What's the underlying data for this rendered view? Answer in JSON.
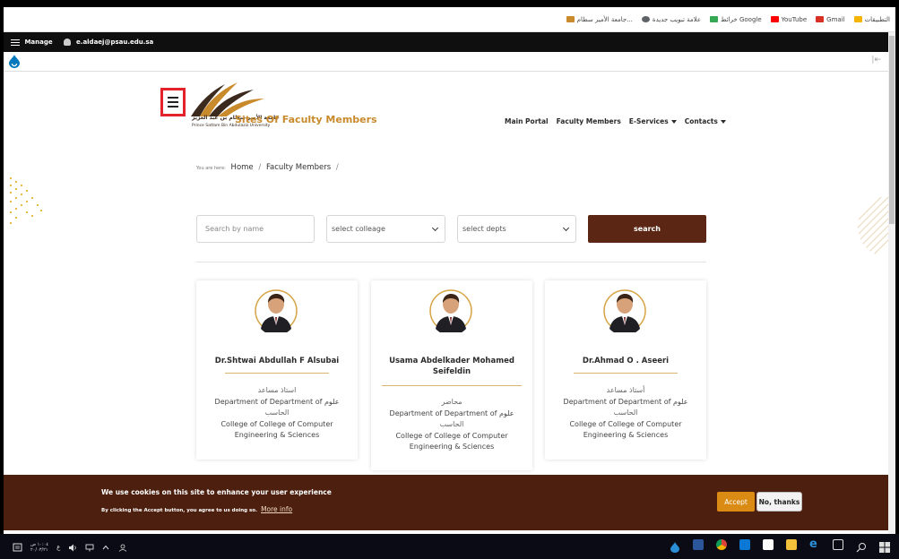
{
  "browser": {
    "bookmarks": [
      {
        "label": "التطبيقات",
        "color": "#f4b400"
      },
      {
        "label": "Gmail",
        "color": "#d93025"
      },
      {
        "label": "YouTube",
        "color": "#ff0000"
      },
      {
        "label": "خرائط Google",
        "color": "#34a853"
      },
      {
        "label": "علامة تبويب جديدة",
        "color": "#5f6368"
      },
      {
        "label": "جامعة الأمير سطام...",
        "color": "#c98a2c"
      }
    ]
  },
  "admin_toolbar": {
    "manage_label": "Manage",
    "user_label": "e.aldaej@psau.edu.sa",
    "collapse_glyph": "|⇤"
  },
  "header": {
    "university_name_ar": "جامعة الأمير سطام بن عبد العزيز",
    "university_name_en": "Prince Sattam Bin Abdulaziz University",
    "site_title": "Sites Of Faculty Members",
    "nav": [
      {
        "label": "Main Portal",
        "dropdown": false
      },
      {
        "label": "Faculty Members",
        "dropdown": false
      },
      {
        "label": "E-Services",
        "dropdown": true
      },
      {
        "label": "Contacts",
        "dropdown": true
      }
    ]
  },
  "breadcrumb": {
    "prefix": "You are here:",
    "items": [
      "Home",
      "Faculty Members"
    ],
    "separator": "/"
  },
  "search_form": {
    "name_placeholder": "Search by name",
    "college_selected": "select colleage",
    "depts_selected": "select depts",
    "button_label": "search"
  },
  "cards": [
    {
      "name": "Dr.Shtwai Abdullah F Alsubai",
      "title_ar": "استاذ مساعد",
      "department": "Department of Department of علوم",
      "department_ar": "الحاسب",
      "college": "College of College of Computer Engineering & Sciences"
    },
    {
      "name": "Usama Abdelkader Mohamed Seifeldin",
      "title_ar": "محاضر",
      "department": "Department of Department of علوم",
      "department_ar": "الحاسب",
      "college": "College of College of Computer Engineering & Sciences"
    },
    {
      "name": "Dr.Ahmad O . Aseeri",
      "title_ar": "أستاذ مساعد",
      "department": "Department of Department of علوم",
      "department_ar": "الحاسب",
      "college": "College of College of Computer Engineering & Sciences"
    }
  ],
  "cookie_banner": {
    "title": "We use cookies on this site to enhance your user experience",
    "description": "By clicking the Accept button, you agree to us doing so.",
    "more_info": "More info",
    "accept_label": "Accept",
    "decline_label": "No, thanks"
  },
  "taskbar": {
    "time": "١٠:٠٤ ص",
    "date": "٢٠/٠٣/٢١",
    "lang": "ع"
  },
  "colors": {
    "brand_dark": "#5b2714",
    "cookie_bg": "#4c1f0e",
    "accent_gold": "#c98a2c",
    "accept_orange": "#d98b14",
    "highlight_red": "#e3222c"
  }
}
